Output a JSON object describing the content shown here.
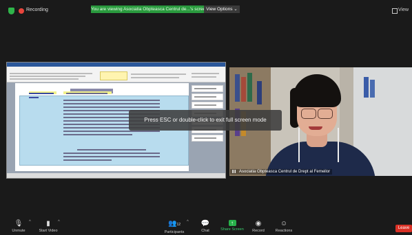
{
  "topbar": {
    "recording_label": "Recording",
    "banner_text": "You are viewing Asociatia Obpteasca Centrul de...'s screen",
    "view_options_label": "View Options ⌄",
    "view_label": "View"
  },
  "toast": {
    "text": "Press ESC or double-click to exit full screen mode"
  },
  "video": {
    "participant_name": "Asociatia Obpteasca Centrul de Drept al Femeilor"
  },
  "toolbar": {
    "unmute_label": "Unmute",
    "start_video_label": "Start Video",
    "participants_label": "Participants",
    "participants_count": "12",
    "chat_label": "Chat",
    "share_screen_label": "Share Screen",
    "record_label": "Record",
    "reactions_label": "Reactions",
    "leave_label": "Leave"
  },
  "colors": {
    "banner_green": "#2a9a3e",
    "leave_red": "#d93025",
    "share_green": "#27b24a",
    "background": "#1a1a1a"
  },
  "icons": [
    "shield-icon",
    "record-dot-icon",
    "mic-muted-icon",
    "video-off-icon",
    "participants-icon",
    "chat-icon",
    "share-screen-icon",
    "record-icon",
    "reactions-icon"
  ]
}
